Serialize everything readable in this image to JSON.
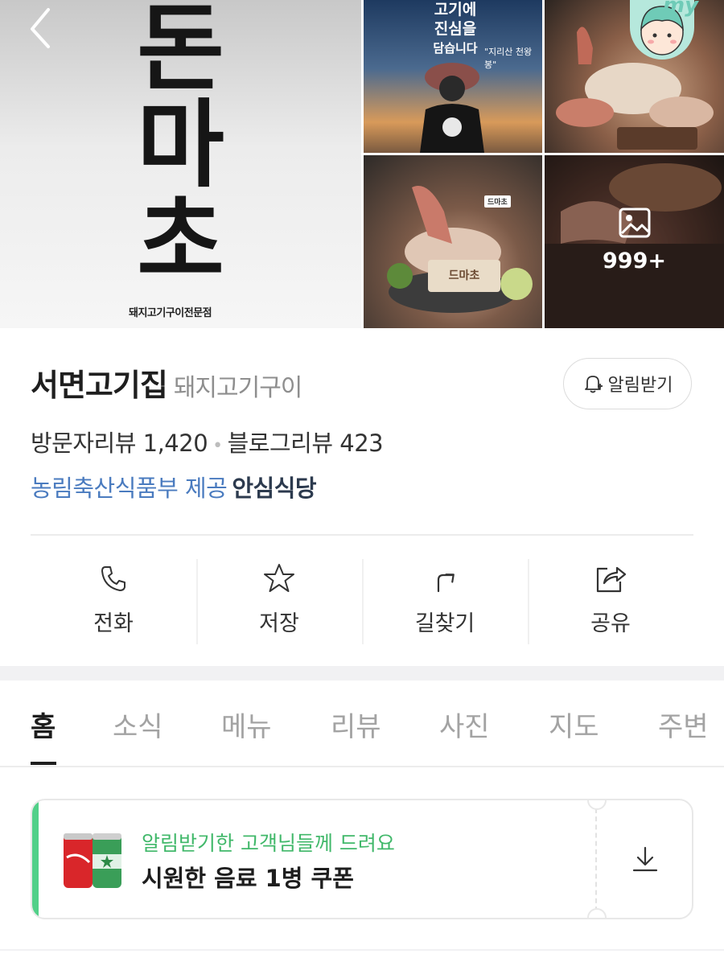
{
  "gallery": {
    "hero_logo_chars": [
      "돈",
      "마",
      "초"
    ],
    "hero_subtitle": "돼지고기구이전문점",
    "tile1_lines": [
      "고기에",
      "진심을",
      "담습니다"
    ],
    "tile1_quote": "\"지리산 천왕봉\"",
    "tile3_badge": "드마초",
    "tile3_board": "드마초",
    "more_count": "999+",
    "avatar_label": "my"
  },
  "place": {
    "name": "서면고기집",
    "category": "돼지고기구이",
    "notify_label": "알림받기",
    "visitor_reviews": "방문자리뷰 1,420",
    "blog_reviews": "블로그리뷰 423",
    "cert_provider": "농림축산식품부 제공",
    "cert_badge": "안심식당"
  },
  "actions": [
    {
      "label": "전화",
      "icon": "phone-icon"
    },
    {
      "label": "저장",
      "icon": "star-icon"
    },
    {
      "label": "길찾기",
      "icon": "directions-icon"
    },
    {
      "label": "공유",
      "icon": "share-icon"
    }
  ],
  "tabs": [
    "홈",
    "소식",
    "메뉴",
    "리뷰",
    "사진",
    "지도",
    "주변"
  ],
  "active_tab": "홈",
  "coupon": {
    "tag": "알림받기한 고객님들께 드려요",
    "title": "시원한 음료 1병 쿠폰"
  },
  "colors": {
    "accent_green": "#41b86a",
    "coupon_bar": "#52d089",
    "link_blue": "#4a7bbf",
    "cert_dark": "#2c3a4e"
  }
}
